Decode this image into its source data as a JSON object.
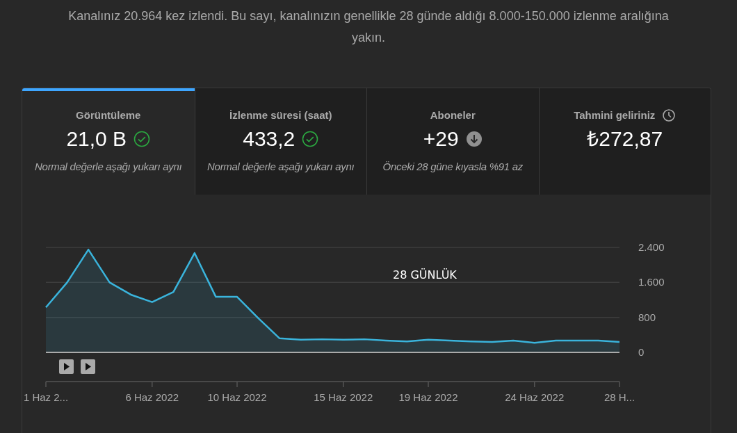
{
  "summary": "Kanalınız 20.964 kez izlendi. Bu sayı, kanalınızın genellikle 28 günde aldığı 8.000-150.000 izlenme aralığına yakın.",
  "tabs": [
    {
      "title": "Görüntüleme",
      "value": "21,0 B",
      "kind": "normal",
      "note": "Normal değerle aşağı yukarı aynı",
      "selected": true
    },
    {
      "title": "İzlenme süresi (saat)",
      "value": "433,2",
      "kind": "normal",
      "note": "Normal değerle aşağı yukarı aynı",
      "selected": false
    },
    {
      "title": "Aboneler",
      "value": "+29",
      "kind": "down",
      "note": "Önceki 28 güne kıyasla %91 az",
      "selected": false
    },
    {
      "title": "Tahmini geliriniz",
      "value": "₺272,87",
      "kind": "pending",
      "selected": false
    }
  ],
  "chart": {
    "chart_data": {
      "type": "area",
      "annotations": [
        "28 GÜNLÜK"
      ],
      "categories": [
        "1 Haz 2...",
        null,
        null,
        null,
        null,
        "6 Haz 2022",
        null,
        null,
        null,
        "10 Haz 2022",
        null,
        null,
        null,
        null,
        "15 Haz 2022",
        null,
        null,
        null,
        "19 Haz 2022",
        null,
        null,
        null,
        null,
        "24 Haz 2022",
        null,
        null,
        null,
        "28 H..."
      ],
      "series": [
        {
          "color": "#3ab4dc",
          "values": [
            1030,
            1600,
            2350,
            1600,
            1320,
            1150,
            1380,
            2270,
            1270,
            1270,
            780,
            320,
            290,
            300,
            290,
            300,
            270,
            250,
            290,
            270,
            250,
            240,
            270,
            220,
            270,
            270,
            270,
            240
          ]
        }
      ],
      "ylim": [
        0,
        2400
      ],
      "yticks": [
        {
          "value": 0,
          "label": "0"
        },
        {
          "value": 800,
          "label": "800"
        },
        {
          "value": 1600,
          "label": "1.600"
        },
        {
          "value": 2400,
          "label": "2.400"
        }
      ]
    }
  }
}
